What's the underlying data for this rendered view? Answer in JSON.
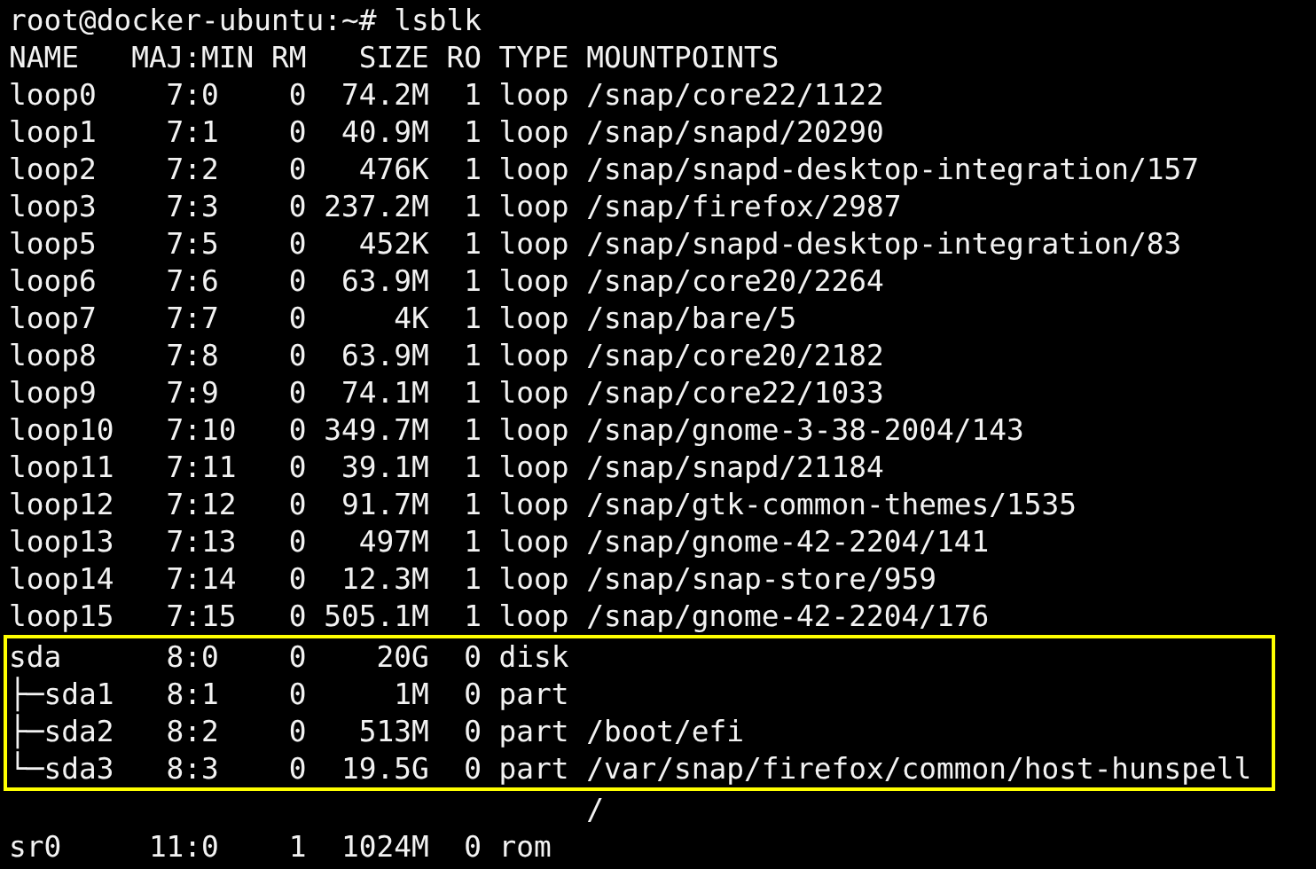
{
  "prompt": "root@docker-ubuntu:~# lsblk",
  "lines": [
    "NAME   MAJ:MIN RM   SIZE RO TYPE MOUNTPOINTS",
    "loop0    7:0    0  74.2M  1 loop /snap/core22/1122",
    "loop1    7:1    0  40.9M  1 loop /snap/snapd/20290",
    "loop2    7:2    0   476K  1 loop /snap/snapd-desktop-integration/157",
    "loop3    7:3    0 237.2M  1 loop /snap/firefox/2987",
    "loop5    7:5    0   452K  1 loop /snap/snapd-desktop-integration/83",
    "loop6    7:6    0  63.9M  1 loop /snap/core20/2264",
    "loop7    7:7    0     4K  1 loop /snap/bare/5",
    "loop8    7:8    0  63.9M  1 loop /snap/core20/2182",
    "loop9    7:9    0  74.1M  1 loop /snap/core22/1033",
    "loop10   7:10   0 349.7M  1 loop /snap/gnome-3-38-2004/143",
    "loop11   7:11   0  39.1M  1 loop /snap/snapd/21184",
    "loop12   7:12   0  91.7M  1 loop /snap/gtk-common-themes/1535",
    "loop13   7:13   0   497M  1 loop /snap/gnome-42-2204/141",
    "loop14   7:14   0  12.3M  1 loop /snap/snap-store/959",
    "loop15   7:15   0 505.1M  1 loop /snap/gnome-42-2204/176"
  ],
  "highlighted_lines": [
    "sda      8:0    0    20G  0 disk",
    "├─sda1   8:1    0     1M  0 part",
    "├─sda2   8:2    0   513M  0 part /boot/efi",
    "└─sda3   8:3    0  19.5G  0 part /var/snap/firefox/common/host-hunspell"
  ],
  "after_lines": [
    "                                 /",
    "sr0     11:0    1  1024M  0 rom"
  ]
}
